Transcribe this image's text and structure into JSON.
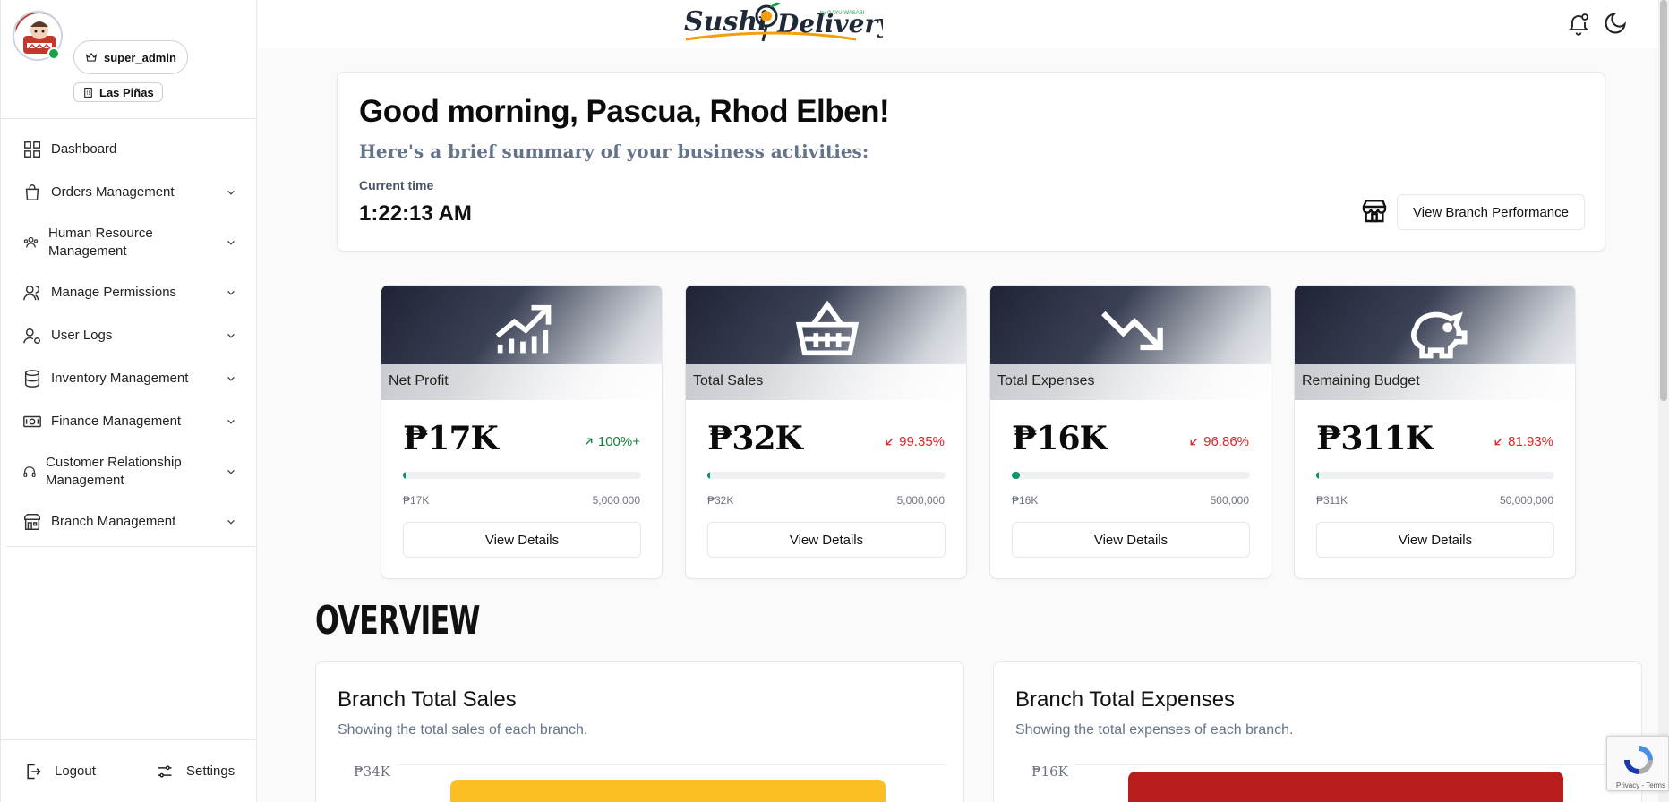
{
  "sidebar": {
    "role": "super_admin",
    "branch": "Las Piñas",
    "items": [
      {
        "label": "Dashboard",
        "icon": "dashboard-icon",
        "has_chevron": false
      },
      {
        "label": "Orders Management",
        "icon": "shopping-bag-icon",
        "has_chevron": true
      },
      {
        "label": "Human Resource Management",
        "icon": "team-icon",
        "has_chevron": true
      },
      {
        "label": "Manage Permissions",
        "icon": "users-icon",
        "has_chevron": true
      },
      {
        "label": "User Logs",
        "icon": "user-cog-icon",
        "has_chevron": true
      },
      {
        "label": "Inventory Management",
        "icon": "database-icon",
        "has_chevron": true
      },
      {
        "label": "Finance Management",
        "icon": "banknote-icon",
        "has_chevron": true
      },
      {
        "label": "Customer Relationship Management",
        "icon": "headset-icon",
        "has_chevron": true
      },
      {
        "label": "Branch Management",
        "icon": "building-icon",
        "has_chevron": true
      }
    ],
    "logout_label": "Logout",
    "settings_label": "Settings"
  },
  "header": {
    "logo_text": "Sushi Delivery",
    "logo_subtext": "by GAYU WASABI"
  },
  "greeting": {
    "title": "Good morning, Pascua, Rhod Elben!",
    "subtitle": "Here's a brief summary of your business activities:",
    "time_label": "Current time",
    "time_value": "1:22:13 AM",
    "button_label": "View Branch Performance"
  },
  "stats": [
    {
      "title": "Net Profit",
      "value": "₱17K",
      "change": "100%+",
      "trend": "up",
      "progress": 0.0034,
      "min_label": "₱17K",
      "max_label": "5,000,000",
      "button": "View Details",
      "icon": "trending-up-chart-icon"
    },
    {
      "title": "Total Sales",
      "value": "₱32K",
      "change": "99.35%",
      "trend": "down",
      "progress": 0.0064,
      "min_label": "₱32K",
      "max_label": "5,000,000",
      "button": "View Details",
      "icon": "shopping-basket-icon"
    },
    {
      "title": "Total Expenses",
      "value": "₱16K",
      "change": "96.86%",
      "trend": "down",
      "progress": 0.032,
      "min_label": "₱16K",
      "max_label": "500,000",
      "button": "View Details",
      "icon": "trending-down-icon"
    },
    {
      "title": "Remaining Budget",
      "value": "₱311K",
      "change": "81.93%",
      "trend": "down",
      "progress": 0.0062,
      "min_label": "₱311K",
      "max_label": "50,000,000",
      "button": "View Details",
      "icon": "piggy-bank-icon"
    }
  ],
  "overview_heading": "OVERVIEW",
  "charts": [
    {
      "title": "Branch Total Sales",
      "subtitle": "Showing the total sales of each branch.",
      "y_tick": "₱34K",
      "bar_color": "#fbbf24"
    },
    {
      "title": "Branch Total Expenses",
      "subtitle": "Showing the total expenses of each branch.",
      "y_tick": "₱16K",
      "bar_color": "#b91c1c"
    }
  ],
  "chart_data": [
    {
      "type": "bar",
      "title": "Branch Total Sales",
      "y_ticks": [
        "₱34K"
      ],
      "values": [
        32000
      ],
      "color": "#fbbf24"
    },
    {
      "type": "bar",
      "title": "Branch Total Expenses",
      "y_ticks": [
        "₱16K"
      ],
      "values": [
        16000
      ],
      "color": "#b91c1c"
    }
  ],
  "recaptcha": {
    "text": "Privacy - Terms"
  }
}
